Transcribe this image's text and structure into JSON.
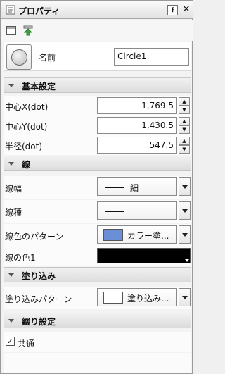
{
  "window": {
    "title": "プロパティ",
    "pin_glyph": "⭱",
    "close_glyph": "✕"
  },
  "object": {
    "name_label": "名前",
    "name_value": "Circle1"
  },
  "sections": {
    "basic": "基本設定",
    "line": "線",
    "fill": "塗り込み",
    "tile": "綴り設定"
  },
  "basic": {
    "center_x_label": "中心X(dot)",
    "center_x_value": "1,769.5",
    "center_y_label": "中心Y(dot)",
    "center_y_value": "1,430.5",
    "radius_label": "半径(dot)",
    "radius_value": "547.5"
  },
  "line": {
    "width_label": "線幅",
    "width_value": "細",
    "type_label": "線種",
    "color_pattern_label": "線色のパターン",
    "color_pattern_value": "カラー塗...",
    "color1_label": "線の色1"
  },
  "fill": {
    "pattern_label": "塗り込みパターン",
    "pattern_value": "塗り込み..."
  },
  "tile": {
    "common_label": "共通",
    "common_checked": true
  },
  "colors": {
    "line_pattern_swatch": "#6b8fd6",
    "line_color1": "#000000",
    "fill_swatch": "#ffffff"
  },
  "icons": {
    "spin_up": "▲",
    "spin_down": "▼",
    "check": "✓"
  }
}
